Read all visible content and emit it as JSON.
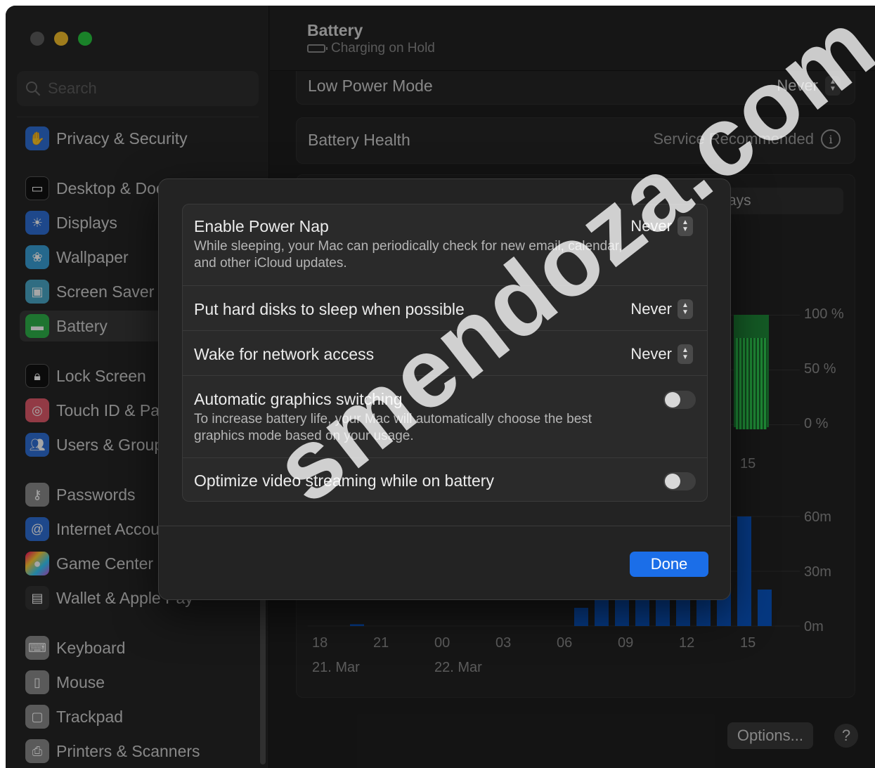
{
  "window": {
    "traffic_lights": {
      "close": "#5d5d5d",
      "minimize": "#f5bf2c",
      "zoom": "#29c840"
    }
  },
  "sidebar": {
    "search_placeholder": "Search",
    "items": [
      {
        "label": "Privacy & Security",
        "icon": "hand-icon",
        "color": "#2f6fd6"
      },
      {
        "label": "Desktop & Dock",
        "icon": "dock-icon",
        "color": "#1a1a1a"
      },
      {
        "label": "Displays",
        "icon": "sun-icon",
        "color": "#2f6fd6"
      },
      {
        "label": "Wallpaper",
        "icon": "flower-icon",
        "color": "#3aa0d8"
      },
      {
        "label": "Screen Saver",
        "icon": "screen-icon",
        "color": "#4aa8c8"
      },
      {
        "label": "Battery",
        "icon": "battery-icon",
        "color": "#2fb34a"
      },
      {
        "label": "Lock Screen",
        "icon": "lock-icon",
        "color": "#1a1a1a"
      },
      {
        "label": "Touch ID & Password",
        "icon": "fingerprint-icon",
        "color": "#e05a6a"
      },
      {
        "label": "Users & Groups",
        "icon": "users-icon",
        "color": "#2f6fd6"
      },
      {
        "label": "Passwords",
        "icon": "key-icon",
        "color": "#8a8a8a"
      },
      {
        "label": "Internet Accounts",
        "icon": "at-icon",
        "color": "#2f6fd6"
      },
      {
        "label": "Game Center",
        "icon": "game-center-icon",
        "color": "#c45ad8"
      },
      {
        "label": "Wallet & Apple Pay",
        "icon": "wallet-icon",
        "color": "#333333"
      },
      {
        "label": "Keyboard",
        "icon": "keyboard-icon",
        "color": "#8a8a8a"
      },
      {
        "label": "Mouse",
        "icon": "mouse-icon",
        "color": "#8a8a8a"
      },
      {
        "label": "Trackpad",
        "icon": "trackpad-icon",
        "color": "#8a8a8a"
      },
      {
        "label": "Printers & Scanners",
        "icon": "printer-icon",
        "color": "#8a8a8a"
      }
    ],
    "selected": "Battery"
  },
  "main": {
    "title": "Battery",
    "subtitle": "Charging on Hold",
    "low_power": {
      "label": "Low Power Mode",
      "value": "Never"
    },
    "battery_health": {
      "label": "Battery Health",
      "value": "Service Recommended"
    },
    "range_tab_fragment": "ays",
    "chart_labels": {
      "level_ticks": [
        "100 %",
        "50 %",
        "0 %"
      ],
      "level_x_fragment": "15",
      "usage_ticks": [
        "60m",
        "30m",
        "0m"
      ],
      "usage_x": [
        "18",
        "21",
        "00",
        "03",
        "06",
        "09",
        "12",
        "15"
      ],
      "dates": [
        "21. Mar",
        "22. Mar"
      ]
    },
    "options_label": "Options...",
    "help_label": "?"
  },
  "chart_data": {
    "type": "bar",
    "title": "",
    "xlabel": "",
    "ylabel": "",
    "categories": [
      "18",
      "19",
      "20",
      "21",
      "22",
      "23",
      "00",
      "01",
      "02",
      "03",
      "04",
      "05",
      "06",
      "07",
      "08",
      "09",
      "10",
      "11",
      "12",
      "13",
      "14",
      "15",
      "16"
    ],
    "values": [
      0,
      0,
      1,
      0,
      0,
      0,
      0,
      0,
      0,
      0,
      0,
      0,
      0,
      10,
      25,
      25,
      25,
      25,
      25,
      25,
      25,
      60,
      20
    ],
    "ylim": [
      0,
      60
    ],
    "y_unit": "m"
  },
  "modal": {
    "rows": [
      {
        "title": "Enable Power Nap",
        "desc": "While sleeping, your Mac can periodically check for new email, calendar, and other iCloud updates.",
        "control": "popup",
        "value": "Never"
      },
      {
        "title": "Put hard disks to sleep when possible",
        "control": "popup",
        "value": "Never"
      },
      {
        "title": "Wake for network access",
        "control": "popup",
        "value": "Never"
      },
      {
        "title": "Automatic graphics switching",
        "desc": "To increase battery life, your Mac will automatically choose the best graphics mode based on your usage.",
        "control": "toggle",
        "on": false
      },
      {
        "title": "Optimize video streaming while on battery",
        "control": "toggle",
        "on": false
      }
    ],
    "done_label": "Done",
    "accent": "#1b6ee8"
  },
  "watermark": "smendoza.com"
}
